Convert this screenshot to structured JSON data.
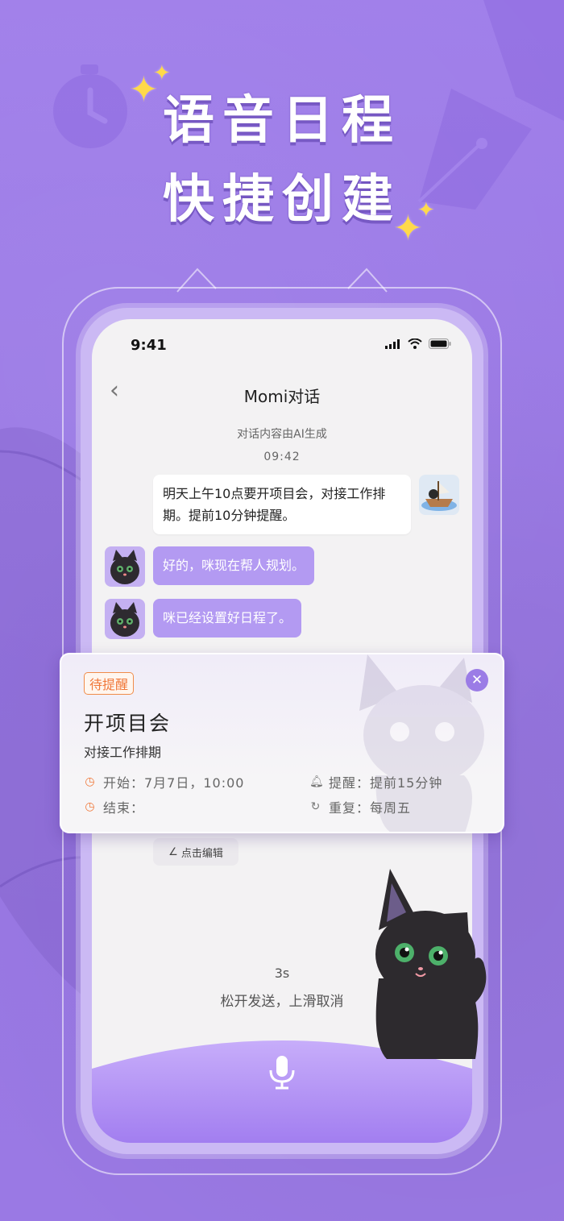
{
  "headline": {
    "line1": "语音日程",
    "line2": "快捷创建"
  },
  "status_bar": {
    "time": "9:41"
  },
  "nav": {
    "title": "Momi对话"
  },
  "chat": {
    "disclaimer": "对话内容由AI生成",
    "timestamp": "09:42",
    "user_message": "明天上午10点要开项目会，对接工作排期。提前10分钟提醒。",
    "bot_messages": [
      "好的，咪现在帮人规划。",
      "咪已经设置好日程了。"
    ],
    "edit_label": "点击编辑"
  },
  "schedule_card": {
    "badge": "待提醒",
    "title": "开项目会",
    "subtitle": "对接工作排期",
    "start": "开始：7月7日，10:00",
    "end": "结束：",
    "reminder": "提醒：提前15分钟",
    "repeat": "重复：每周五"
  },
  "recording": {
    "countdown": "3s",
    "hint": "松开发送，上滑取消"
  },
  "colors": {
    "accent": "#9b7ae6",
    "badge": "#f0783a",
    "bot_bubble": "#b39af2"
  },
  "icons": [
    "sparkle-icon",
    "stopwatch-icon",
    "pen-icon",
    "back-icon",
    "signal-icon",
    "wifi-icon",
    "battery-icon",
    "close-icon",
    "clock-icon",
    "bell-icon",
    "repeat-icon",
    "edit-icon",
    "microphone-icon"
  ]
}
